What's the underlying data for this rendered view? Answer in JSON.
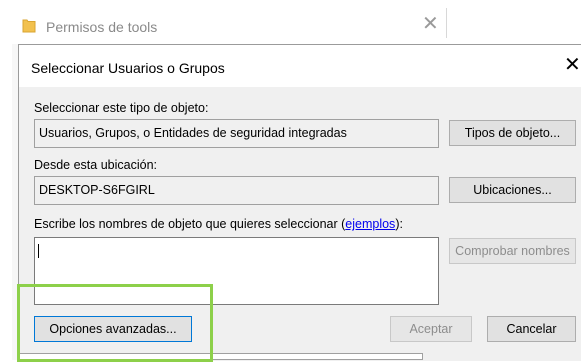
{
  "background_window": {
    "title": "Permisos de tools",
    "close_symbol": "✕"
  },
  "dialog": {
    "title": "Seleccionar Usuarios o Grupos",
    "close_symbol": "✕",
    "object_type": {
      "label": "Seleccionar este tipo de objeto:",
      "value": "Usuarios, Grupos, o Entidades de seguridad integradas",
      "button": "Tipos de objeto..."
    },
    "location": {
      "label": "Desde esta ubicación:",
      "value": "DESKTOP-S6FGIRL",
      "button": "Ubicaciones..."
    },
    "names": {
      "label_prefix": "Escribe los nombres de objeto que quieres seleccionar (",
      "label_link": "ejemplos",
      "label_suffix": "):",
      "value": "",
      "check_button": "Comprobar nombres"
    },
    "advanced_button": "Opciones avanzadas...",
    "accept_button": "Aceptar",
    "cancel_button": "Cancelar"
  },
  "colors": {
    "highlight": "#8dd04a",
    "link": "#0000ee",
    "dialog_bg": "#f0f0f0"
  }
}
